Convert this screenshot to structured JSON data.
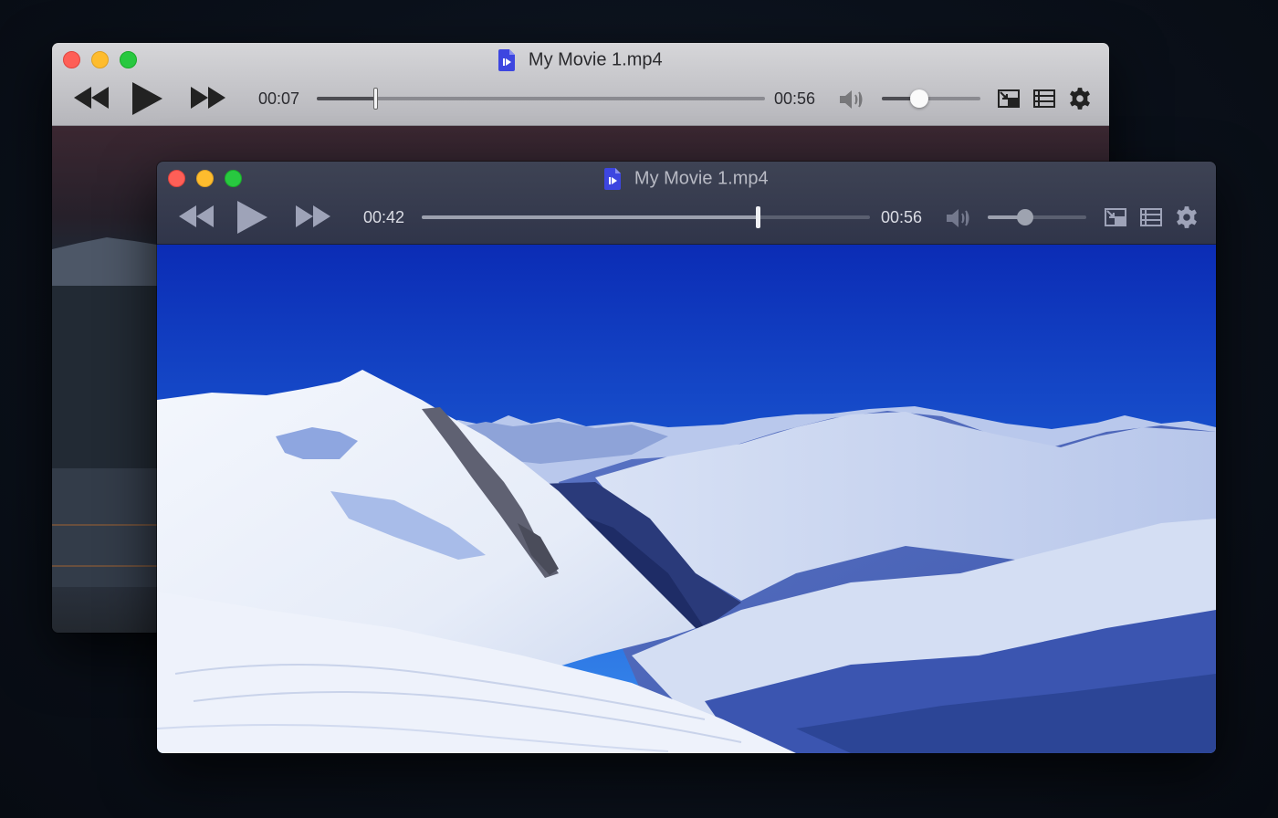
{
  "back_window": {
    "title": "My Movie 1.mp4",
    "current_time": "00:07",
    "duration": "00:56",
    "progress": 0.13,
    "volume": 0.38
  },
  "front_window": {
    "title": "My Movie 1.mp4",
    "current_time": "00:42",
    "duration": "00:56",
    "progress": 0.75,
    "volume": 0.38
  },
  "icons": {
    "window_controls": [
      "close",
      "minimize",
      "zoom"
    ],
    "playback": [
      "rewind-icon",
      "play-icon",
      "fast-forward-icon"
    ],
    "right_controls": [
      "volume-icon",
      "picture-in-picture-icon",
      "playlist-icon",
      "gear-icon"
    ],
    "file": "video-file-icon"
  },
  "colors": {
    "close": "#fe5f57",
    "minimize": "#febc2e",
    "zoom": "#28c840",
    "file_icon": "#3d46e0"
  }
}
